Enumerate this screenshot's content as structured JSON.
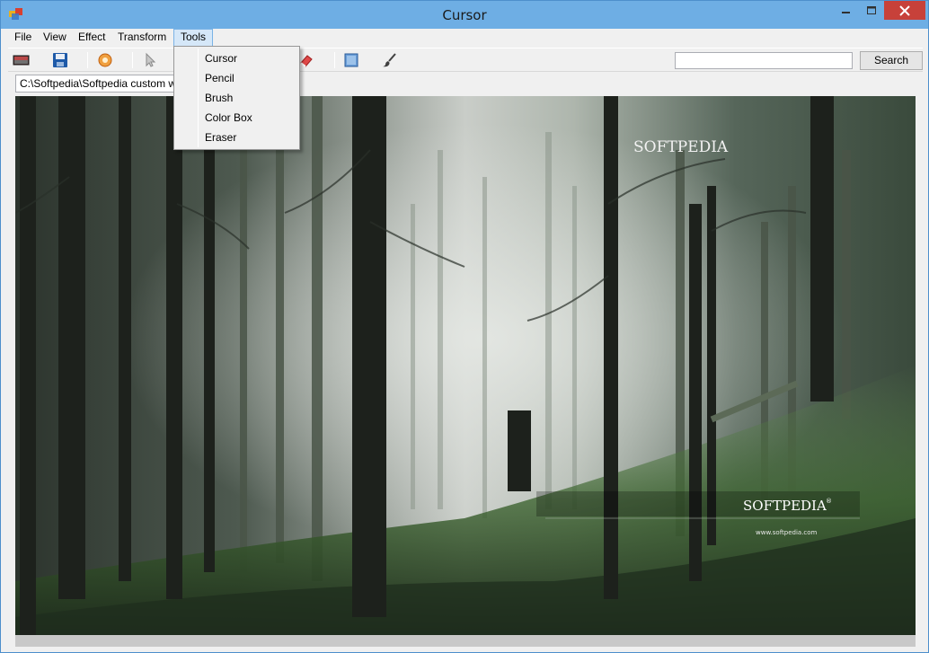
{
  "window": {
    "title": "Cursor"
  },
  "menu": {
    "items": [
      "File",
      "View",
      "Effect",
      "Transform",
      "Tools"
    ],
    "active": "Tools"
  },
  "tools_menu": {
    "items": [
      "Cursor",
      "Pencil",
      "Brush",
      "Color Box",
      "Eraser"
    ]
  },
  "toolbar": {
    "search_value": "",
    "search_label": "Search"
  },
  "path": {
    "value": "C:\\Softpedia\\Softpedia custom wallp"
  },
  "image": {
    "watermark_top": "SOFTPEDIA",
    "watermark_bottom": "SOFTPEDIA",
    "watermark_mark": "®",
    "watermark_url": "www.softpedia.com"
  },
  "colors": {
    "titlebar": "#6eaee4",
    "close_button": "#c7413a",
    "menu_highlight": "#d5e7f8"
  }
}
